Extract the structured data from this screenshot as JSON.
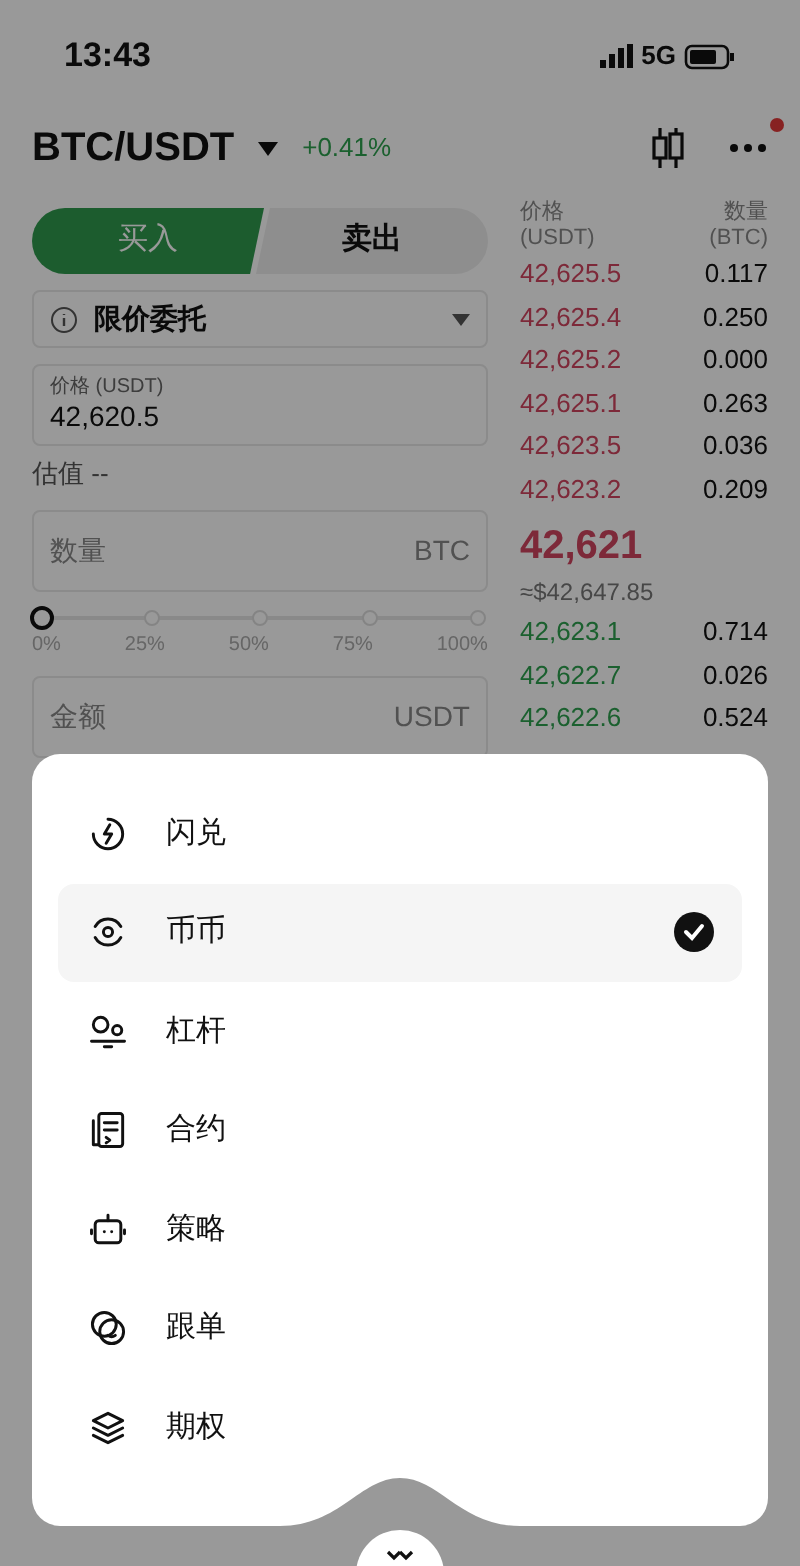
{
  "status_bar": {
    "time": "13:43",
    "network": "5G"
  },
  "header": {
    "pair": "BTC/USDT",
    "change": "+0.41%",
    "has_notification": true
  },
  "trade_tabs": [
    {
      "label": "买入",
      "selected": true
    },
    {
      "label": "卖出",
      "selected": false
    }
  ],
  "order_type": {
    "label": "限价委托"
  },
  "price_field": {
    "label": "价格 (USDT)",
    "value": "42,620.5"
  },
  "estimate": "估值 --",
  "amount_field": {
    "placeholder": "数量",
    "unit": "BTC"
  },
  "slider": {
    "level": 0,
    "ticks": [
      "0%",
      "25%",
      "50%",
      "75%",
      "100%"
    ]
  },
  "total_field": {
    "placeholder": "金额",
    "unit": "USDT"
  },
  "order_book": {
    "price_header": [
      "价格",
      "(USDT)"
    ],
    "amount_header": [
      "数量",
      "(BTC)"
    ],
    "asks": [
      {
        "price": "42,625.5",
        "amount": "0.117"
      },
      {
        "price": "42,625.4",
        "amount": "0.250"
      },
      {
        "price": "42,625.2",
        "amount": "0.000"
      },
      {
        "price": "42,625.1",
        "amount": "0.263"
      },
      {
        "price": "42,623.5",
        "amount": "0.036"
      },
      {
        "price": "42,623.2",
        "amount": "0.209"
      }
    ],
    "last_price": "42,621",
    "last_price_usd": "≈$42,647.85",
    "bids": [
      {
        "price": "42,623.1",
        "amount": "0.714"
      },
      {
        "price": "42,622.7",
        "amount": "0.026"
      },
      {
        "price": "42,622.6",
        "amount": "0.524"
      }
    ]
  },
  "menu": {
    "items": [
      {
        "label": "闪兑",
        "selected": false
      },
      {
        "label": "币币",
        "selected": true
      },
      {
        "label": "杠杆",
        "selected": false
      },
      {
        "label": "合约",
        "selected": false
      },
      {
        "label": "策略",
        "selected": false
      },
      {
        "label": "跟单",
        "selected": false
      },
      {
        "label": "期权",
        "selected": false
      }
    ]
  }
}
